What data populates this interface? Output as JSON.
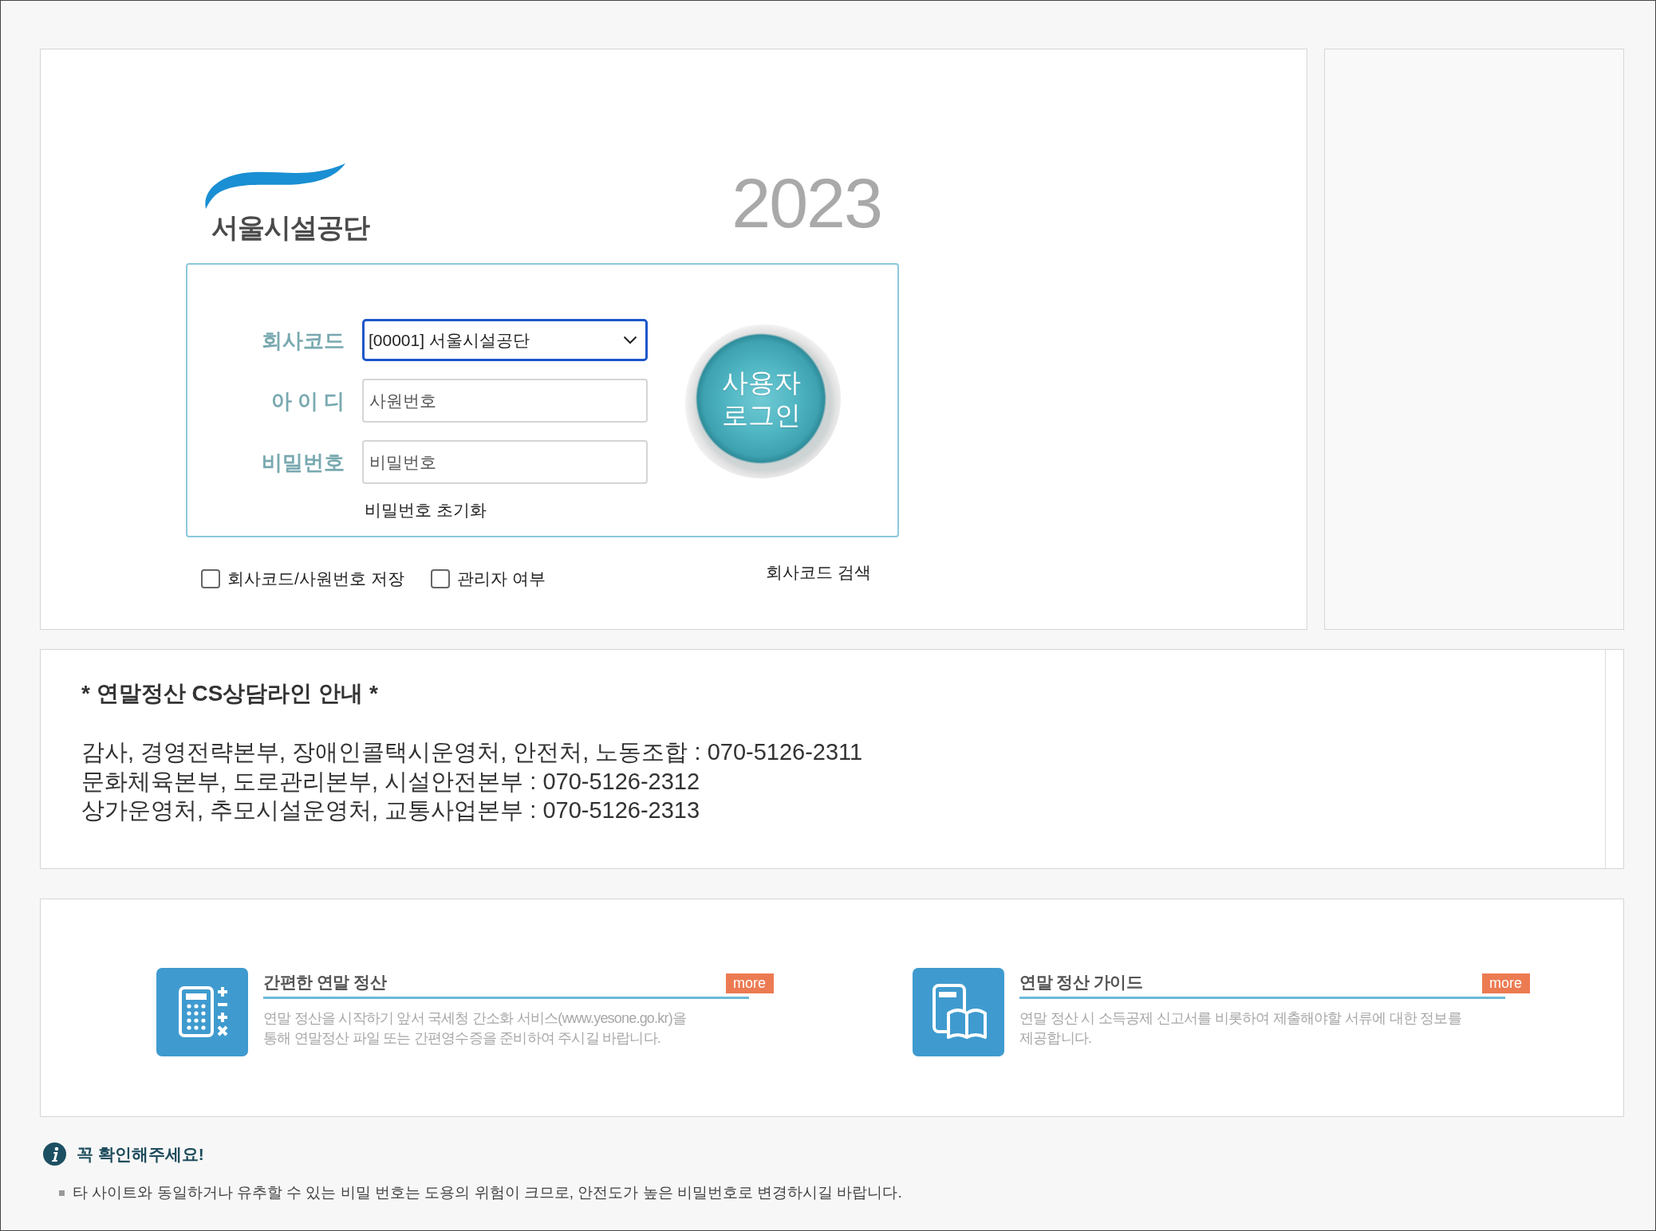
{
  "logo": {
    "text": "서울시설공단"
  },
  "year": "2023",
  "login_form": {
    "fields": [
      {
        "kind": "select",
        "label": "회사코드",
        "value": "[00001] 서울시설공단",
        "focused": true
      },
      {
        "kind": "text",
        "label": "아 이 디",
        "placeholder": "사원번호",
        "focused": false
      },
      {
        "kind": "password",
        "label": "비밀번호",
        "placeholder": "비밀번호",
        "focused": false
      }
    ],
    "reset_link": "비밀번호 초기화",
    "login_button": "사용자\n로그인"
  },
  "options": [
    {
      "label": "회사코드/사원번호 저장",
      "checked": false
    },
    {
      "label": "관리자 여부",
      "checked": false
    }
  ],
  "company_search_link": "회사코드 검색",
  "cs_notice": {
    "title": "* 연말정산 CS상담라인 안내 *",
    "lines": [
      "감사, 경영전략본부, 장애인콜택시운영처, 안전처, 노동조합 : 070-5126-2311",
      "문화체육본부, 도로관리본부, 시설안전본부 : 070-5126-2312",
      "상가운영처, 추모시설운영처, 교통사업본부 : 070-5126-2313"
    ]
  },
  "guides": [
    {
      "kind": "calculator",
      "title": "간편한 연말 정산",
      "badge": "more",
      "description": "연말 정산을 시작하기 앞서 국세청 간소화 서비스(www.yesone.go.kr)을\n통해 연말정산 파일 또는 간편영수증을 준비하여 주시길 바랍니다."
    },
    {
      "kind": "book",
      "title": "연말 정산 가이드",
      "badge": "more",
      "description": "연말 정산 시 소득공제 신고서를 비롯하여 제출해야할 서류에 대한 정보를\n제공합니다."
    }
  ],
  "notice": {
    "title": "꼭 확인해주세요!",
    "items": [
      "타 사이트와 동일하거나 유추할 수 있는 비밀 번호는 도용의 위험이 크므로, 안전도가 높은 비밀번호로 변경하시길 바랍니다."
    ]
  }
}
